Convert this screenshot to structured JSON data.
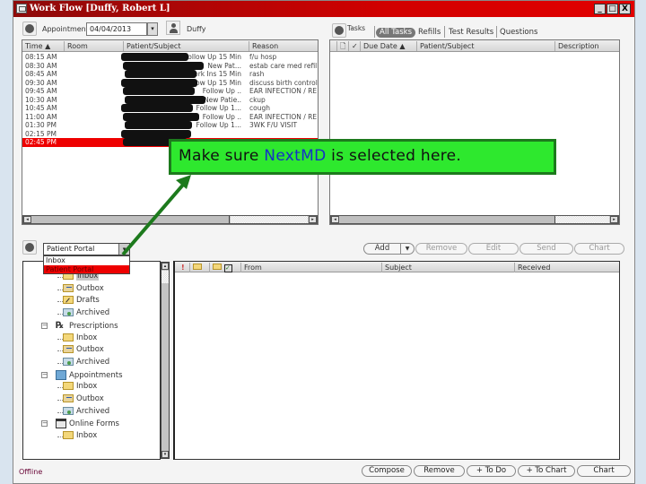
{
  "window": {
    "title": "Work Flow [Duffy, Robert L]",
    "controls": [
      "_",
      "□",
      "X"
    ]
  },
  "appointments": {
    "label": "Appointments",
    "date": "04/04/2013",
    "provider": "Duffy",
    "columns": [
      "Time",
      "Room",
      "Patient/Subject",
      "Reason"
    ],
    "rows": [
      {
        "time": "08:15 AM",
        "room": "",
        "subject": "Follow Up 15 Min",
        "reason": "f/u hosp"
      },
      {
        "time": "08:30 AM",
        "room": "",
        "subject": "New Pat...",
        "reason": "estab care med refill"
      },
      {
        "time": "08:45 AM",
        "room": "",
        "subject": "Work Ins 15 Min",
        "reason": "rash"
      },
      {
        "time": "09:30 AM",
        "room": "",
        "subject": "Follow Up 15 Min",
        "reason": "discuss birth control"
      },
      {
        "time": "09:45 AM",
        "room": "",
        "subject": "Follow Up ..",
        "reason": "EAR INFECTION / RE"
      },
      {
        "time": "10:30 AM",
        "room": "",
        "subject": "New Patie..",
        "reason": "ckup"
      },
      {
        "time": "10:45 AM",
        "room": "",
        "subject": "Follow Up 1...",
        "reason": "cough"
      },
      {
        "time": "11:00 AM",
        "room": "",
        "subject": "Follow Up ..",
        "reason": "EAR INFECTION / RE"
      },
      {
        "time": "01:30 PM",
        "room": "",
        "subject": "Follow Up 1...",
        "reason": "3WK F/U VISIT"
      },
      {
        "time": "02:15 PM",
        "room": "",
        "subject": "",
        "reason": ""
      },
      {
        "time": "02:45 PM",
        "room": "",
        "subject": "",
        "reason": "",
        "selected": true
      }
    ]
  },
  "tasks": {
    "label": "Tasks",
    "tabs": [
      "All Tasks",
      "Refills",
      "Test Results",
      "Questions"
    ],
    "active_tab": "All Tasks",
    "columns": [
      "Due Date",
      "Patient/Subject",
      "Description"
    ],
    "buttons": {
      "add": "Add",
      "remove": "Remove",
      "edit": "Edit",
      "send": "Send",
      "chart": "Chart"
    }
  },
  "inbox": {
    "source_select": "Patient Portal",
    "source_options": [
      "Inbox",
      "Patient Portal"
    ],
    "tree": [
      {
        "label": "Inbox",
        "type": "inbox",
        "highlight": true
      },
      {
        "label": "Outbox",
        "type": "out"
      },
      {
        "label": "Drafts",
        "type": "draft"
      },
      {
        "label": "Archived",
        "type": "arch"
      },
      {
        "label": "Prescriptions",
        "type": "category"
      },
      {
        "label": "Inbox",
        "type": "inbox"
      },
      {
        "label": "Outbox",
        "type": "out"
      },
      {
        "label": "Archived",
        "type": "arch"
      },
      {
        "label": "Appointments",
        "type": "category"
      },
      {
        "label": "Inbox",
        "type": "inbox"
      },
      {
        "label": "Outbox",
        "type": "out"
      },
      {
        "label": "Archived",
        "type": "arch"
      },
      {
        "label": "Online Forms",
        "type": "category"
      },
      {
        "label": "Inbox",
        "type": "inbox"
      }
    ],
    "columns": [
      "From",
      "Subject",
      "Received"
    ],
    "buttons": {
      "compose": "Compose",
      "remove": "Remove",
      "todo": "+ To Do",
      "tochart": "+ To Chart",
      "chart": "Chart"
    }
  },
  "status": "Offline",
  "callout": {
    "before": "Make sure ",
    "highlight": "NextMD",
    "after": " is selected here.",
    "fill_color": "#2ee82e",
    "border_color": "#1d7a1d",
    "highlight_color": "#1530c8"
  }
}
